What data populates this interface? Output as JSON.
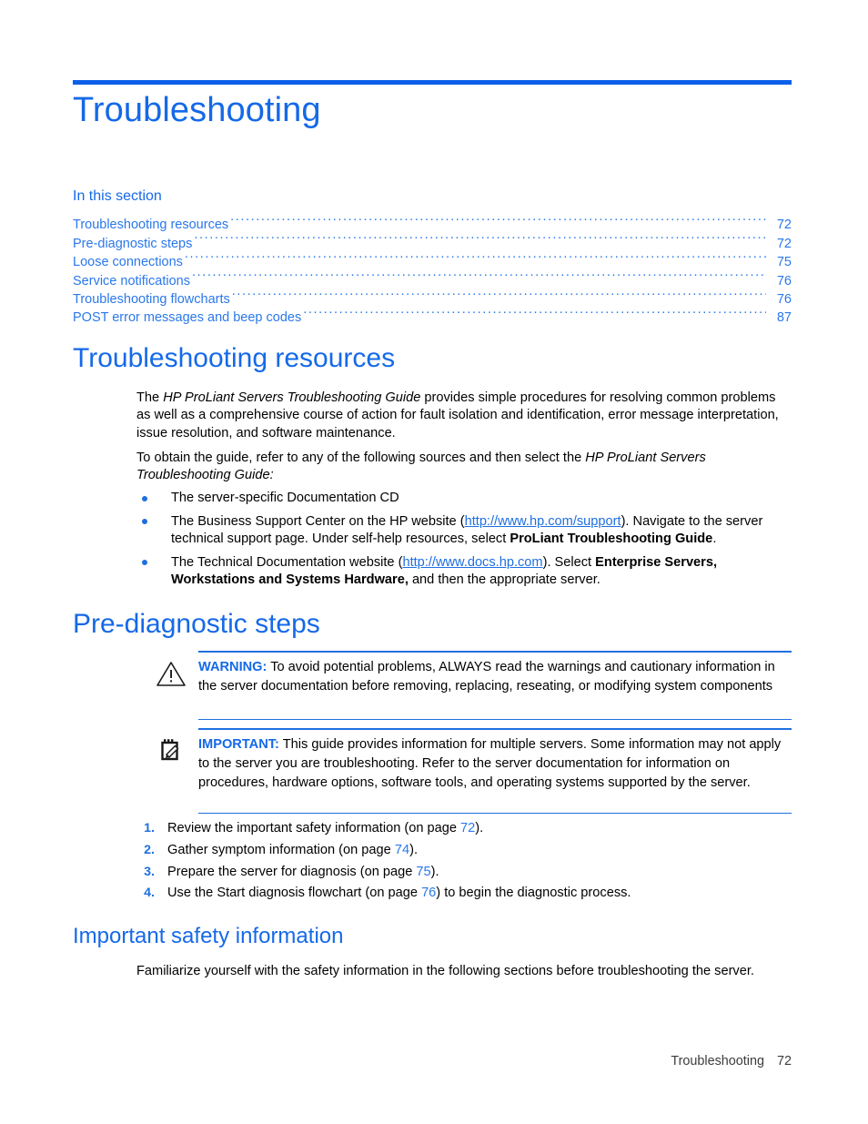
{
  "document": {
    "chapter_title": "Troubleshooting",
    "accent_blue": "#1569e8",
    "rule_blue": "#0b5fe8",
    "link_blue": "#1f6fe0"
  },
  "toc": {
    "label": "In this section",
    "entries": [
      {
        "title": "Troubleshooting resources",
        "page": "72"
      },
      {
        "title": "Pre-diagnostic steps",
        "page": "72"
      },
      {
        "title": "Loose connections",
        "page": "75"
      },
      {
        "title": "Service notifications",
        "page": "76"
      },
      {
        "title": "Troubleshooting flowcharts",
        "page": "76"
      },
      {
        "title": "POST error messages and beep codes",
        "page": "87"
      }
    ]
  },
  "sections": {
    "resources": {
      "heading": "Troubleshooting resources",
      "para1_a": "The ",
      "para1_italic": "HP ProLiant Servers Troubleshooting Guide",
      "para1_b": " provides simple procedures for resolving common problems as well as a comprehensive course of action for fault isolation and identification, error message interpretation, issue resolution, and software maintenance.",
      "para2_a": "To obtain the guide, refer to any of the following sources and then select the ",
      "para2_italic": "HP ProLiant Servers Troubleshooting Guide:",
      "bullets": {
        "b1": "The server-specific Documentation CD",
        "b2_a": "The Business Support Center on the HP website (",
        "b2_link": "http://www.hp.com/support",
        "b2_b": "). Navigate to the server technical support page. Under self-help resources, select ",
        "b2_bold": "ProLiant Troubleshooting Guide",
        "b2_c": ".",
        "b3_a": "The Technical Documentation website (",
        "b3_link": "http://www.docs.hp.com",
        "b3_b": "). Select ",
        "b3_bold1": "Enterprise Servers, Workstations and Systems Hardware,",
        "b3_c": " and then the appropriate server."
      }
    },
    "prediagnostic": {
      "heading": "Pre-diagnostic steps",
      "warning": {
        "icon": "warning-triangle-icon",
        "label": "WARNING:",
        "text": " To avoid potential problems, ALWAYS read the warnings and cautionary information in the server documentation before removing, replacing, reseating, or modifying system components"
      },
      "important": {
        "icon": "note-pencil-icon",
        "label": "IMPORTANT:",
        "text": " This guide provides information for multiple servers. Some information may not apply to the server you are troubleshooting. Refer to the server documentation for information on procedures, hardware options, software tools, and operating systems supported by the server."
      },
      "steps": [
        {
          "num": "1.",
          "text_a": "Review the important safety information (on page ",
          "page": "72",
          "text_b": ")."
        },
        {
          "num": "2.",
          "text_a": "Gather symptom information (on page ",
          "page": "74",
          "text_b": ")."
        },
        {
          "num": "3.",
          "text_a": "Prepare the server for diagnosis (on page ",
          "page": "75",
          "text_b": ")."
        },
        {
          "num": "4.",
          "text_a": "Use the Start diagnosis flowchart (on page ",
          "page": "76",
          "text_b": ") to begin the diagnostic process."
        }
      ]
    },
    "safety": {
      "heading": "Important safety information",
      "para": "Familiarize yourself with the safety information in the following sections before troubleshooting the server."
    }
  },
  "footer": {
    "chapter": "Troubleshooting",
    "page": "72"
  }
}
